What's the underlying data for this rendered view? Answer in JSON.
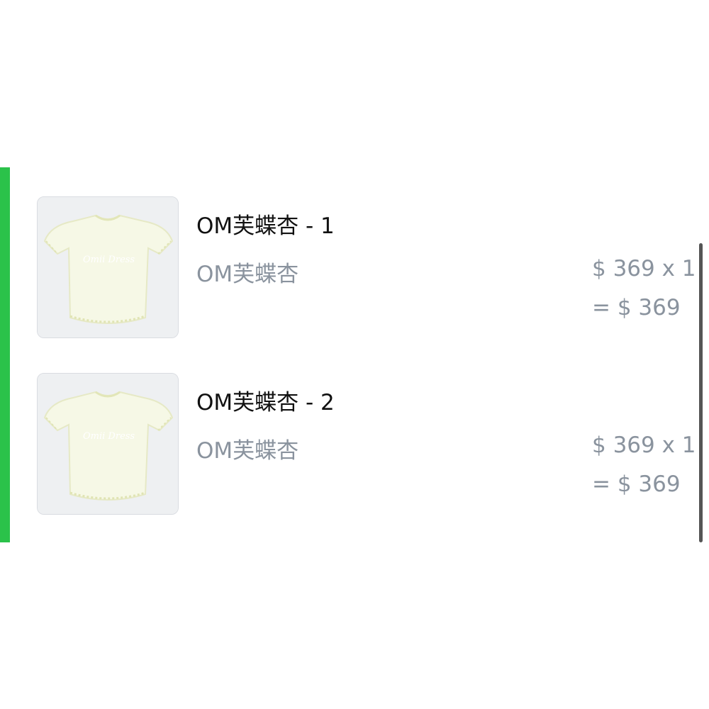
{
  "colors": {
    "accent": "#2bc24a",
    "title_text": "#111111",
    "secondary_text": "#8a939e",
    "scrollbar": "#555555"
  },
  "items": [
    {
      "title": "OM芙蝶杏 - 1",
      "subtitle": "OM芙蝶杏",
      "price_line": "$ 369 x 1",
      "total_line": "= $ 369",
      "image_brand_text": "Omii Dress",
      "image_icon": "dress-photo"
    },
    {
      "title": "OM芙蝶杏 - 2",
      "subtitle": "OM芙蝶杏",
      "price_line": "$ 369 x 1",
      "total_line": "= $ 369",
      "image_brand_text": "Omii Dress",
      "image_icon": "dress-photo"
    }
  ]
}
